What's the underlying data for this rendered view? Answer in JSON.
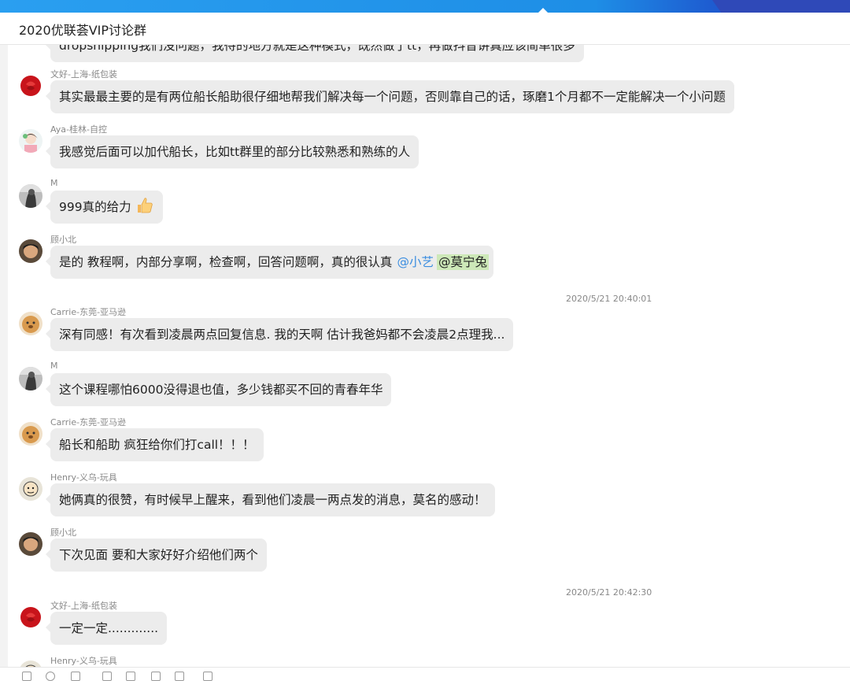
{
  "window": {
    "title": "2020优联荟VIP讨论群"
  },
  "messages": [
    {
      "sender": "",
      "text": "dropshipping我们没问题，我待的地方就是这种模式，既然做了tt，再做抖音讲真应该简单很多"
    },
    {
      "sender": "文好-上海-纸包装",
      "text": "其实最最主要的是有两位船长船助很仔细地帮我们解决每一个问题，否则靠自己的话，琢磨1个月都不一定能解决一个小问题"
    },
    {
      "sender": "Aya-桂林-自控",
      "text": "我感觉后面可以加代船长，比如tt群里的部分比较熟悉和熟练的人"
    },
    {
      "sender": "M",
      "text": "999真的给力"
    },
    {
      "sender": "顾小北",
      "text": "是的 教程啊，内部分享啊，检查啊，回答问题啊，真的很认真",
      "mention1": "@小艺",
      "mention2": "@莫宁兔"
    },
    {
      "sender": "Carrie-东莞-亚马逊",
      "text": "深有同感！有次看到凌晨两点回复信息. 我的天啊 估计我爸妈都不会凌晨2点理我..."
    },
    {
      "sender": "M",
      "text": "这个课程哪怕6000没得退也值，多少钱都买不回的青春年华"
    },
    {
      "sender": "Carrie-东莞-亚马逊",
      "text": "船长和船助 疯狂给你们打call！！！"
    },
    {
      "sender": "Henry-义乌-玩具",
      "text": "她俩真的很赞，有时候早上醒来，看到他们凌晨一两点发的消息，莫名的感动！"
    },
    {
      "sender": "顾小北",
      "text": "下次见面 要和大家好好介绍他们两个"
    },
    {
      "sender": "文好-上海-纸包装",
      "text": "一定一定............."
    },
    {
      "sender": "Henry-义乌-玩具",
      "text": ""
    }
  ],
  "timestamps": [
    "2020/5/21 20:40:01",
    "2020/5/21 20:42:30"
  ],
  "colors": {
    "accent": "#1e8ee6",
    "bubble": "#ececec",
    "mention": "#3a8de0",
    "mention_highlight": "#cde8b8"
  },
  "icons": {
    "thumbs_up": "thumbs-up-emoji"
  }
}
